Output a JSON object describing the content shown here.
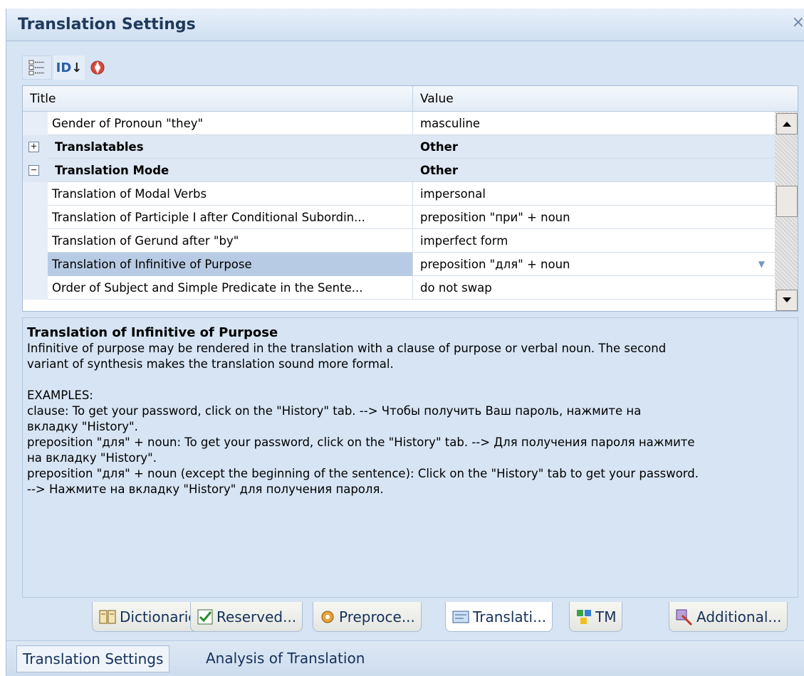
{
  "window": {
    "title": "Translation Settings",
    "close_glyph": "×"
  },
  "toolbar": {
    "icons": [
      "categorized-view-icon",
      "sort-alphabetical-icon",
      "help-icon"
    ],
    "sort_label": "ID"
  },
  "grid": {
    "columns": {
      "title": "Title",
      "value": "Value"
    },
    "rows": [
      {
        "title": "Gender of Pronoun \"they\"",
        "value": "masculine",
        "kind": "item"
      },
      {
        "title": "Translatables",
        "value": "Other",
        "kind": "category",
        "expander": "+"
      },
      {
        "title": "Translation Mode",
        "value": "Other",
        "kind": "category",
        "expander": "−"
      },
      {
        "title": "Translation of Modal Verbs",
        "value": "impersonal",
        "kind": "item"
      },
      {
        "title": "Translation of Participle I after Conditional Subordin...",
        "value": "preposition \"при\" + noun",
        "kind": "item"
      },
      {
        "title": "Translation of Gerund after \"by\"",
        "value": "imperfect form",
        "kind": "item"
      },
      {
        "title": "Translation of Infinitive of Purpose",
        "value": "preposition \"для\" + noun",
        "kind": "item",
        "selected": true
      },
      {
        "title": "Order of Subject and Simple Predicate in the Sente...",
        "value": "do not swap",
        "kind": "item"
      }
    ]
  },
  "description": {
    "heading": "Translation of Infinitive of Purpose",
    "body": "Infinitive of purpose may be rendered in the translation with a clause of purpose or verbal noun. The second\nvariant of synthesis makes the translation sound more formal.",
    "examples": "EXAMPLES:\nclause: To get your password, click on the \"History\" tab. --> Чтобы получить Ваш пароль, нажмите на\nвкладку \"History\".\npreposition \"для\" + noun: To get your password, click on the \"History\" tab. --> Для получения пароля нажмите\nна вкладку \"History\".\npreposition \"для\" + noun (except the beginning of the sentence): Click on the \"History\" tab to get your password.\n--> Нажмите на вкладку \"History\" для получения пароля."
  },
  "tabs": [
    {
      "label": "Dictionaries",
      "icon": "dictionary-icon"
    },
    {
      "label": "Reserved...",
      "icon": "reserved-icon"
    },
    {
      "label": "Preproce...",
      "icon": "preprocessing-icon"
    },
    {
      "label": "Translati...",
      "icon": "translation-icon",
      "active": true
    },
    {
      "label": "TM",
      "icon": "tm-icon"
    },
    {
      "label": "Additional...",
      "icon": "additional-icon"
    }
  ],
  "bottom_tabs": [
    {
      "label": "Translation Settings",
      "active": true
    },
    {
      "label": "Analysis of Translation"
    }
  ],
  "colors": {
    "panel": "#d6e4f3",
    "title_text": "#1e395b",
    "selected_row": "#b8cbe4"
  }
}
